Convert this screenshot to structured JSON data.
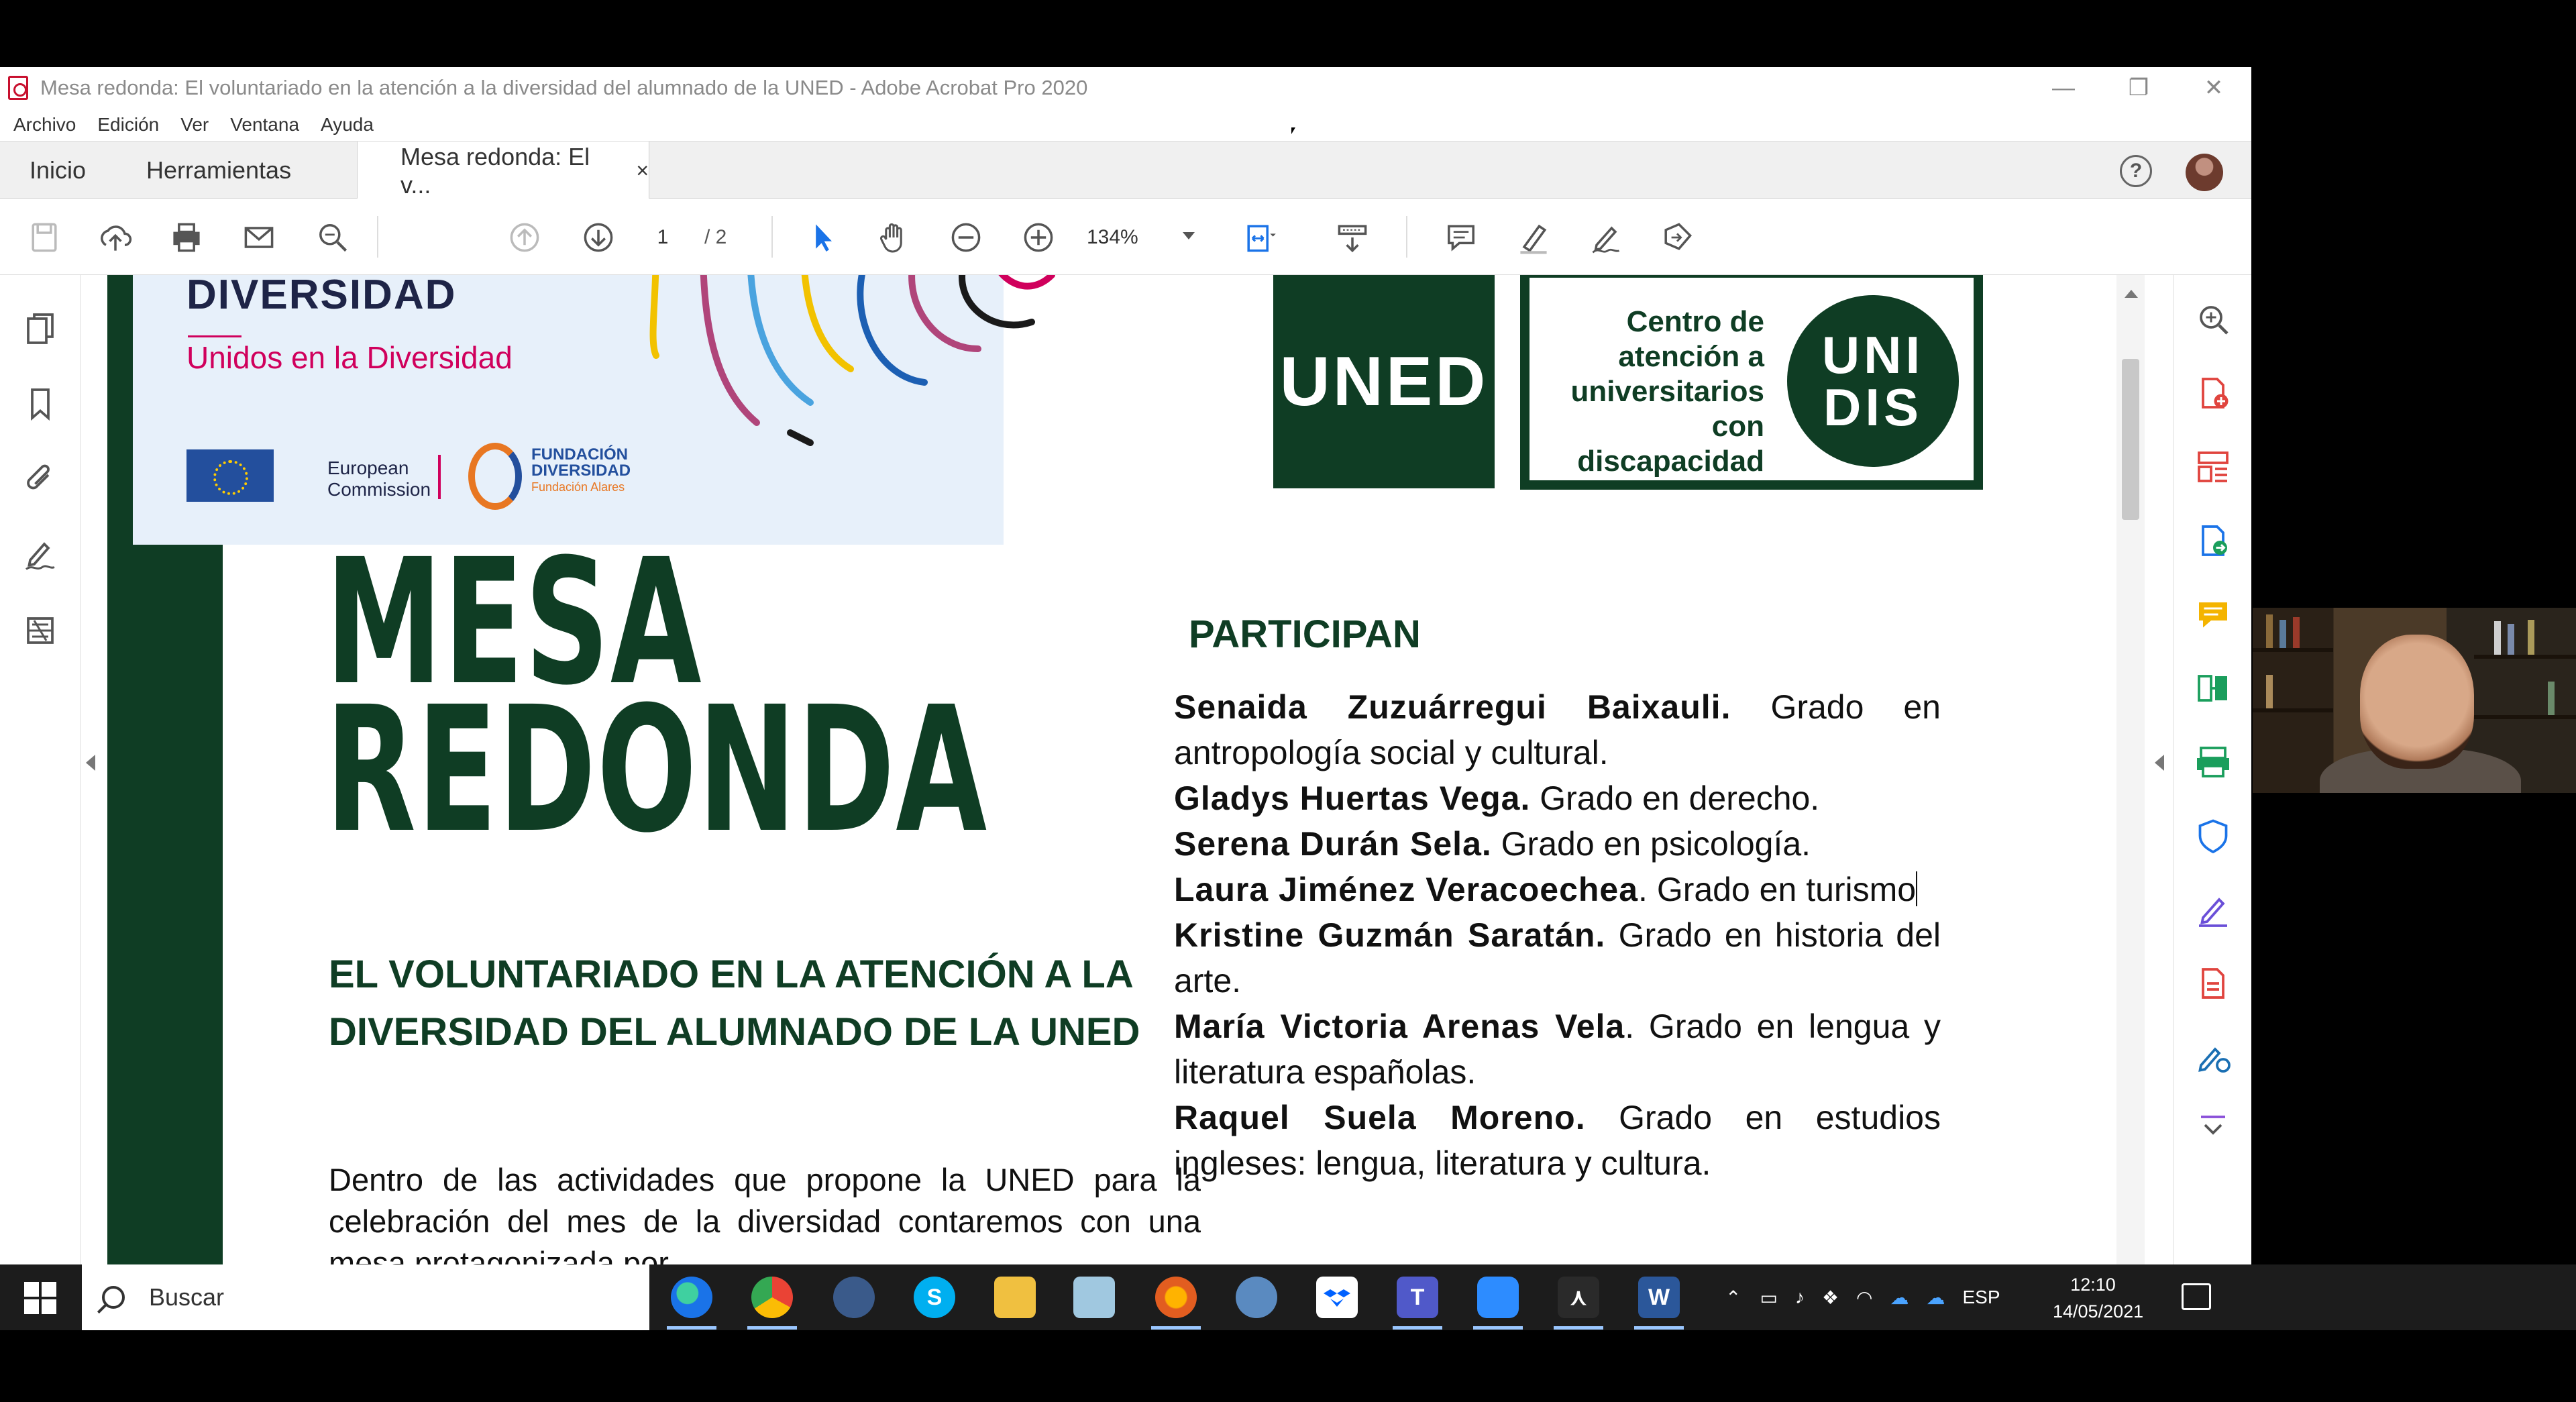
{
  "window": {
    "title": "Mesa redonda: El voluntariado en la atención a la diversidad del alumnado de la UNED - Adobe Acrobat Pro 2020",
    "minimize": "—",
    "restore": "❐",
    "close": "✕"
  },
  "menu": [
    "Archivo",
    "Edición",
    "Ver",
    "Ventana",
    "Ayuda"
  ],
  "tabs": {
    "home": "Inicio",
    "tools": "Herramientas",
    "document": "Mesa redonda: El v...",
    "close": "×"
  },
  "help_label": "?",
  "toolbar": {
    "page_current": "1",
    "page_total": "/ 2",
    "zoom": "134%"
  },
  "document": {
    "banner_heading": "DIVERSIDAD",
    "banner_tagline": "Unidos en la Diversidad",
    "ec_label": "European\nCommission",
    "fundacion_line1": "FUNDACIÓN",
    "fundacion_line2": "DIVERSIDAD",
    "fundacion_line3": "Fundación Alares",
    "uned_logo": "UNED",
    "unidis_text": "Centro de atención a universitarios con discapacidad",
    "unidis_circle_1": "UNI",
    "unidis_circle_2": "DIS",
    "title_1": "MESA",
    "title_2": "REDONDA",
    "subtitle": "EL VOLUNTARIADO EN LA ATENCIÓN A LA DIVERSIDAD DEL ALUMNADO DE LA UNED",
    "intro": "Dentro de las actividades que propone la UNED para la celebración del mes de la diversidad contaremos con una mesa protagonizada por",
    "participan": "PARTICIPAN",
    "participants": [
      {
        "name": "Senaida Zuzuárregui Baixauli.",
        "detail": " Grado en antropología social y cultural."
      },
      {
        "name": "Gladys Huertas Vega.",
        "detail": " Grado en derecho."
      },
      {
        "name": "Serena Durán Sela.",
        "detail": " Grado en psicología."
      },
      {
        "name": "Laura Jiménez Veracoechea",
        "detail": ". Grado en turismo"
      },
      {
        "name": "Kristine Guzmán Saratán.",
        "detail": " Grado en historia del arte."
      },
      {
        "name": "María Victoria Arenas Vela",
        "detail": ". Grado en lengua y literatura españolas."
      },
      {
        "name": "Raquel Suela Moreno.",
        "detail": " Grado en estudios ingleses: lengua, literatura y cultura."
      }
    ]
  },
  "taskbar": {
    "search_placeholder": "Buscar",
    "language": "ESP",
    "time": "12:10",
    "date": "14/05/2021"
  },
  "colors": {
    "brand_green": "#0f3d24",
    "magenta": "#d0005c",
    "acrobat_red": "#c8102e"
  }
}
